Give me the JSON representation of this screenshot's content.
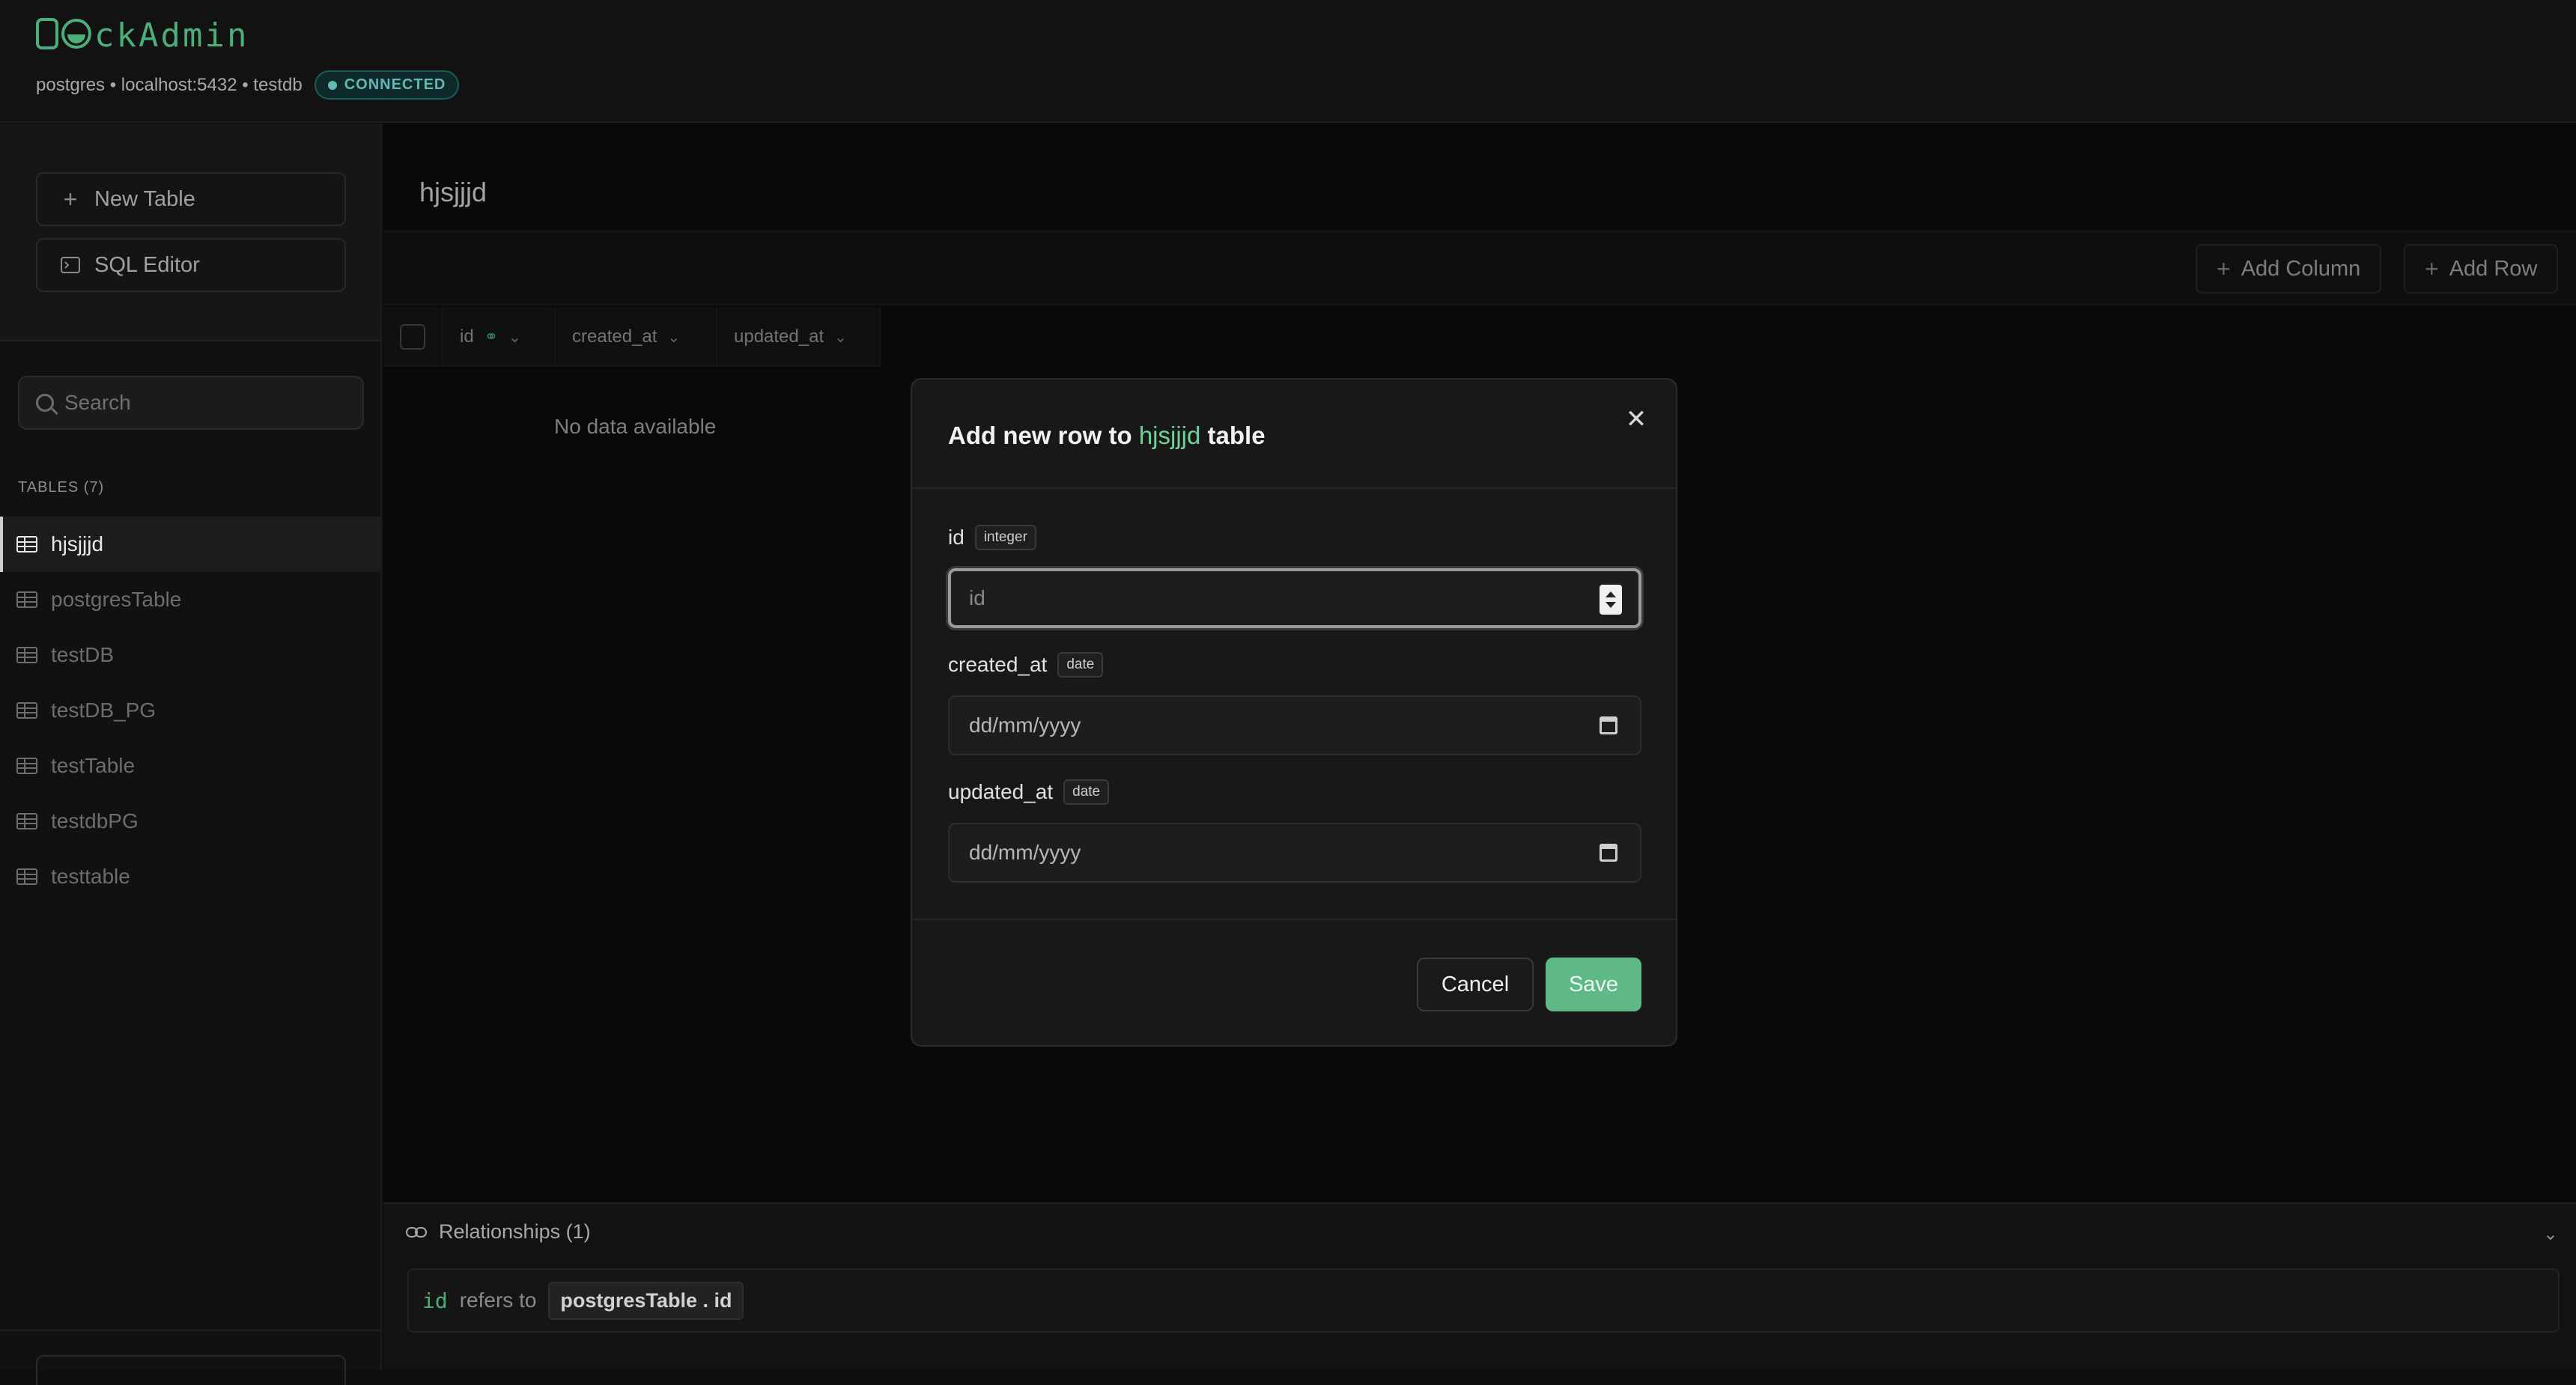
{
  "app": {
    "logo_text": "DockAdmin",
    "connection_info": "postgres • localhost:5432 • testdb",
    "status_badge": "CONNECTED"
  },
  "sidebar": {
    "new_table_label": "New Table",
    "sql_editor_label": "SQL Editor",
    "search_placeholder": "Search",
    "tables_header": "TABLES (7)",
    "tables": [
      "hjsjjjd",
      "postgresTable",
      "testDB",
      "testDB_PG",
      "testTable",
      "testdbPG",
      "testtable"
    ],
    "active_table": "hjsjjjd"
  },
  "main": {
    "title": "hjsjjjd",
    "add_column_label": "Add Column",
    "add_row_label": "Add Row",
    "columns": [
      "id",
      "created_at",
      "updated_at"
    ],
    "empty_text": "No data available",
    "relationships": {
      "header": "Relationships (1)",
      "source_column": "id",
      "refers_text": "refers to",
      "target": "postgresTable . id"
    }
  },
  "modal": {
    "title_prefix": "Add new row to",
    "table_name": "hjsjjjd",
    "title_suffix": "table",
    "fields": [
      {
        "name": "id",
        "type": "integer",
        "placeholder": "id"
      },
      {
        "name": "created_at",
        "type": "date",
        "placeholder": "dd/mm/yyyy"
      },
      {
        "name": "updated_at",
        "type": "date",
        "placeholder": "dd/mm/yyyy"
      }
    ],
    "cancel_label": "Cancel",
    "save_label": "Save"
  },
  "colors": {
    "accent": "#49b07a",
    "save_button": "#5fb987",
    "connected": "#5fbab4"
  },
  "icons": {
    "new_table": "plus-icon",
    "sql_editor": "terminal-icon",
    "search": "search-icon",
    "table": "table-icon",
    "link": "link-icon",
    "close": "close-icon",
    "calendar": "calendar-icon"
  }
}
